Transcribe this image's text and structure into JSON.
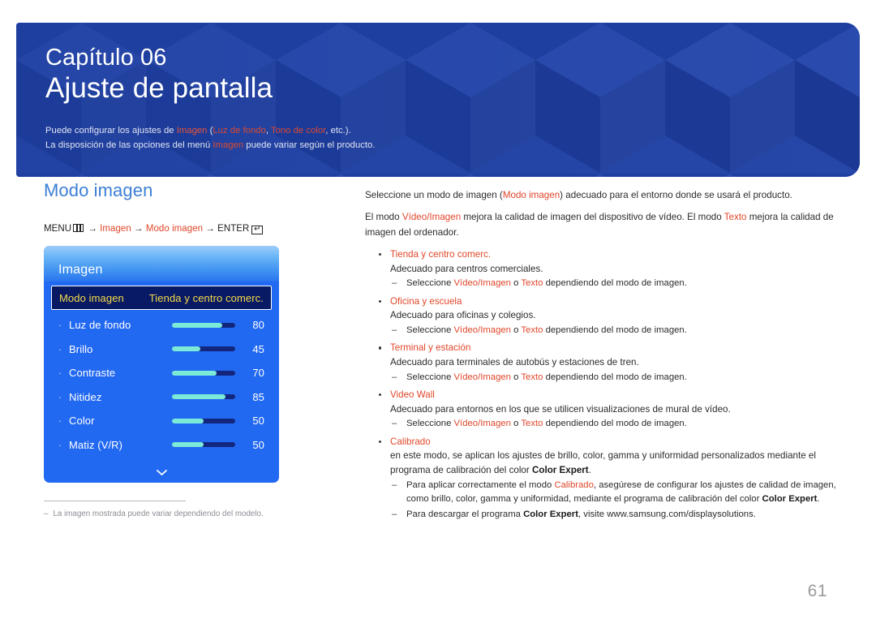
{
  "header": {
    "chapter_label": "Capítulo 06",
    "chapter_title": "Ajuste de pantalla",
    "note_line1_pre": "Puede configurar los ajustes de ",
    "note_line1_k1": "Imagen",
    "note_line1_mid1": " (",
    "note_line1_k2": "Luz de fondo",
    "note_line1_mid2": ", ",
    "note_line1_k3": "Tono de color",
    "note_line1_post": ", etc.).",
    "note_line2_pre": "La disposición de las opciones del menú ",
    "note_line2_k1": "Imagen",
    "note_line2_post": " puede variar según el producto.",
    "accent_blue": "#1f3fa0",
    "accent_red": "#e8553a"
  },
  "left": {
    "section_title": "Modo imagen",
    "menu_path": {
      "menu_word": "MENU",
      "menu_icon": "menu-grid-icon",
      "arrow1": "→",
      "item1": "Imagen",
      "arrow2": "→",
      "item2": "Modo imagen",
      "arrow3": "→",
      "enter_word": "ENTER",
      "enter_icon": "enter-key-icon"
    },
    "osd": {
      "title": "Imagen",
      "selected_row": {
        "label": "Modo imagen",
        "value": "Tienda y centro comerc."
      },
      "rows": [
        {
          "bullet": "·",
          "label": "Luz de fondo",
          "value": "80",
          "percent": 80
        },
        {
          "bullet": "·",
          "label": "Brillo",
          "value": "45",
          "percent": 45
        },
        {
          "bullet": "·",
          "label": "Contraste",
          "value": "70",
          "percent": 70
        },
        {
          "bullet": "·",
          "label": "Nitidez",
          "value": "85",
          "percent": 85
        },
        {
          "bullet": "·",
          "label": "Color",
          "value": "50",
          "percent": 50
        },
        {
          "bullet": "·",
          "label": "Matiz (V/R)",
          "value": "50",
          "percent": 50
        }
      ],
      "scroll_icon": "chevron-down-icon",
      "colors": {
        "panel_bg": "#2269f2",
        "selected_bg": "#081a63",
        "selected_text": "#f5da4a",
        "slider_fill": "#7cead8",
        "slider_track": "#12267e"
      }
    },
    "footnote": {
      "dash": "–",
      "text": "La imagen mostrada puede variar dependiendo del modelo."
    }
  },
  "right": {
    "p1_pre": "Seleccione un modo de imagen (",
    "p1_k1": "Modo imagen",
    "p1_post": ") adecuado para el entorno donde se usará el producto.",
    "p2_pre": "El modo ",
    "p2_k1": "Vídeo/Imagen",
    "p2_mid": " mejora la calidad de imagen del dispositivo de vídeo. El modo ",
    "p2_k2": "Texto",
    "p2_post": " mejora la calidad de imagen del ordenador.",
    "bullets": [
      {
        "title": "Tienda y centro comerc.",
        "desc": "Adecuado para centros comerciales.",
        "subs": [
          {
            "pre": "Seleccione ",
            "k1": "Vídeo/Imagen",
            "mid": " o ",
            "k2": "Texto",
            "post": " dependiendo del modo de imagen."
          }
        ]
      },
      {
        "title": "Oficina y escuela",
        "desc": "Adecuado para oficinas y colegios.",
        "subs": [
          {
            "pre": "Seleccione ",
            "k1": "Vídeo/Imagen",
            "mid": " o ",
            "k2": "Texto",
            "post": " dependiendo del modo de imagen."
          }
        ]
      },
      {
        "title": "Terminal y estación",
        "desc": "Adecuado para terminales de autobús y estaciones de tren.",
        "subs": [
          {
            "pre": "Seleccione ",
            "k1": "Vídeo/Imagen",
            "mid": " o ",
            "k2": "Texto",
            "post": " dependiendo del modo de imagen."
          }
        ]
      },
      {
        "title": "Video Wall",
        "desc": "Adecuado para entornos en los que se utilicen visualizaciones de mural de vídeo.",
        "subs": [
          {
            "pre": "Seleccione ",
            "k1": "Vídeo/Imagen",
            "mid": " o ",
            "k2": "Texto",
            "post": " dependiendo del modo de imagen."
          }
        ]
      }
    ],
    "calibrado": {
      "title": "Calibrado",
      "desc_pre": "en este modo, se aplican los ajustes de brillo, color, gamma y uniformidad personalizados mediante el programa de calibración del color ",
      "desc_bold": "Color Expert",
      "desc_post": ".",
      "sub1_pre": "Para aplicar correctamente el modo ",
      "sub1_k1": "Calibrado",
      "sub1_mid": ", asegúrese de configurar los ajustes de calidad de imagen, como brillo, color, gamma y uniformidad, mediante el programa de calibración del color ",
      "sub1_bold": "Color Expert",
      "sub1_post": ".",
      "sub2_pre": "Para descargar el programa ",
      "sub2_bold": "Color Expert",
      "sub2_post": ", visite www.samsung.com/displaysolutions."
    }
  },
  "page_number": "61"
}
